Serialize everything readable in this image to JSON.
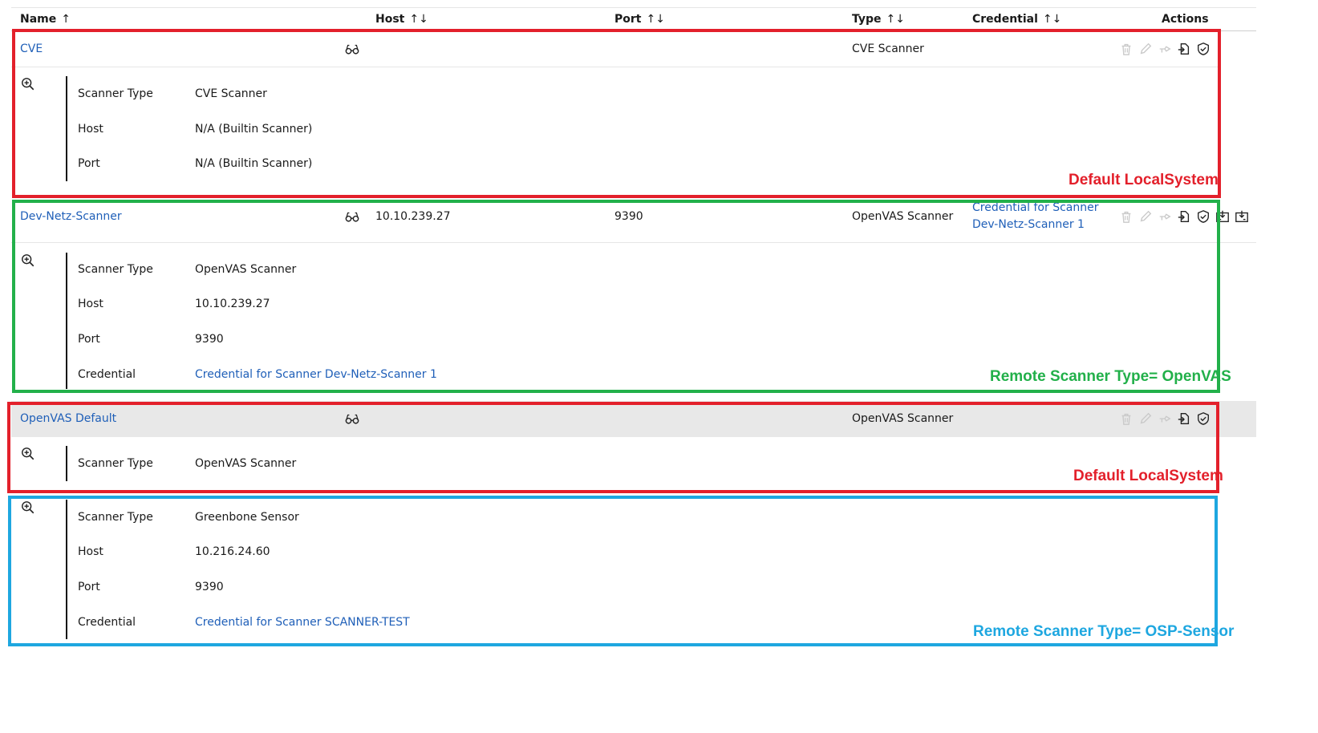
{
  "header": {
    "name": "Name",
    "host": "Host",
    "port": "Port",
    "type": "Type",
    "credential": "Credential",
    "actions": "Actions",
    "name_sort": "↑",
    "host_sort": "↑↓",
    "port_sort": "↑↓",
    "type_sort": "↑↓",
    "credential_sort": "↑↓"
  },
  "scanners": [
    {
      "name": "CVE",
      "host": "",
      "port": "",
      "type": "CVE Scanner",
      "credential": "",
      "details": [
        {
          "label": "Scanner Type",
          "value": "CVE Scanner"
        },
        {
          "label": "Host",
          "value": "N/A (Builtin Scanner)"
        },
        {
          "label": "Port",
          "value": "N/A (Builtin Scanner)"
        }
      ]
    },
    {
      "name": "Dev-Netz-Scanner",
      "host": "10.10.239.27",
      "port": "9390",
      "type": "OpenVAS Scanner",
      "credential_line1": "Credential for Scanner",
      "credential_line2": "Dev-Netz-Scanner 1",
      "details": [
        {
          "label": "Scanner Type",
          "value": "OpenVAS Scanner"
        },
        {
          "label": "Host",
          "value": "10.10.239.27"
        },
        {
          "label": "Port",
          "value": "9390"
        },
        {
          "label": "Credential",
          "value": "Credential for Scanner Dev-Netz-Scanner 1"
        }
      ]
    },
    {
      "name": "OpenVAS Default",
      "host": "",
      "port": "",
      "type": "OpenVAS Scanner",
      "credential": "",
      "details": [
        {
          "label": "Scanner Type",
          "value": "OpenVAS Scanner"
        }
      ]
    },
    {
      "details": [
        {
          "label": "Scanner Type",
          "value": "Greenbone Sensor"
        },
        {
          "label": "Host",
          "value": "10.216.24.60"
        },
        {
          "label": "Port",
          "value": "9390"
        },
        {
          "label": "Credential",
          "value": "Credential for Scanner SCANNER-TEST"
        }
      ]
    }
  ],
  "annotations": {
    "box1": "Default LocalSystem",
    "box2": "Remote Scanner Type= OpenVAS",
    "box3": "Default LocalSystem",
    "box4": "Remote Scanner Type= OSP-Sensor"
  },
  "icons": {
    "view": "glasses-icon",
    "expand": "zoom-in-icon",
    "delete": "trash-icon",
    "edit": "pencil-icon",
    "clone": "clone-icon",
    "export": "export-icon",
    "verify": "shield-check-icon",
    "download_cert": "download-certificate-icon",
    "download_ca": "download-ca-icon"
  },
  "colors": {
    "link": "#1f5fb8",
    "annotation_red": "#e3202b",
    "annotation_green": "#22b04a",
    "annotation_blue": "#1ea7e0",
    "selected_row": "#e8e8e8"
  }
}
